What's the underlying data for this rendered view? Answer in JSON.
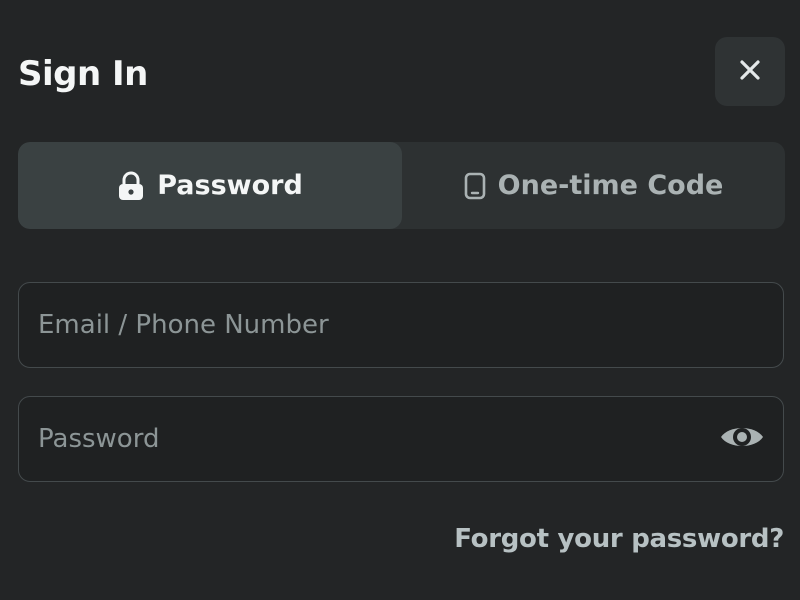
{
  "dialog": {
    "title": "Sign In",
    "close_icon": "close-icon"
  },
  "tabs": [
    {
      "label": "Password",
      "icon": "lock-icon",
      "selected": true
    },
    {
      "label": "One-time Code",
      "icon": "phone-icon",
      "selected": false
    }
  ],
  "form": {
    "email": {
      "placeholder": "Email / Phone Number",
      "value": ""
    },
    "password": {
      "placeholder": "Password",
      "value": "",
      "toggle_icon": "eye-icon"
    },
    "forgot_label": "Forgot your password?"
  },
  "colors": {
    "background": "#232526",
    "tab_bar": "#2d3132",
    "tab_selected": "#3a4142",
    "field_border": "#444a4c",
    "muted_text": "#aab2b3",
    "link_text": "#b7c1c3"
  }
}
